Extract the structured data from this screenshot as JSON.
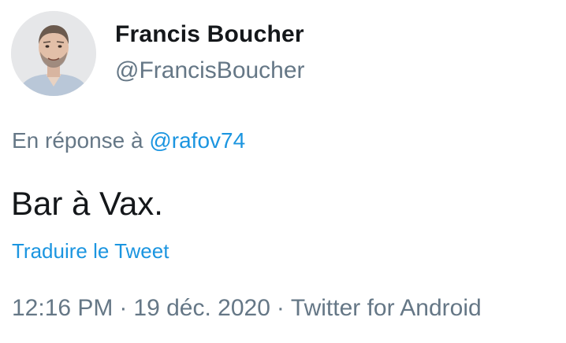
{
  "author": {
    "display_name": "Francis Boucher",
    "handle": "@FrancisBoucher",
    "avatar_icon": "profile-photo"
  },
  "reply": {
    "prefix": "En réponse à",
    "mention": "@rafov74"
  },
  "tweet": {
    "text": "Bar à Vax.",
    "translate_label": "Traduire le Tweet"
  },
  "meta": {
    "time": "12:16 PM",
    "separator": "·",
    "date": "19 déc. 2020",
    "source": "Twitter for Android"
  },
  "colors": {
    "link": "#1b95e0",
    "muted": "#657786",
    "text": "#14171a"
  }
}
